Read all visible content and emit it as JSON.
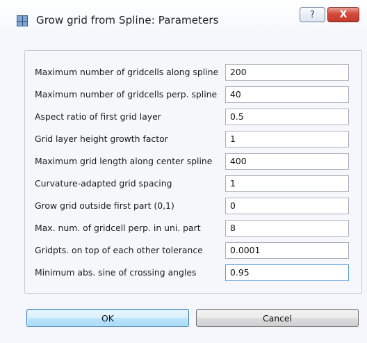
{
  "window": {
    "title": "Grow grid from Spline: Parameters",
    "help_label": "?",
    "close_label": "X"
  },
  "params": [
    {
      "label": "Maximum number of gridcells along spline",
      "value": "200"
    },
    {
      "label": "Maximum number of gridcells perp. spline",
      "value": "40"
    },
    {
      "label": "Aspect ratio of first grid layer",
      "value": "0.5"
    },
    {
      "label": "Grid layer height growth factor",
      "value": "1"
    },
    {
      "label": "Maximum grid length along center spline",
      "value": "400"
    },
    {
      "label": "Curvature-adapted grid spacing",
      "value": "1"
    },
    {
      "label": "Grow grid outside first part (0,1)",
      "value": "0"
    },
    {
      "label": "Max. num. of gridcell perp. in uni. part",
      "value": "8"
    },
    {
      "label": "Gridpts. on top of each other tolerance",
      "value": "0.0001"
    },
    {
      "label": "Minimum abs. sine of crossing angles",
      "value": "0.95"
    }
  ],
  "buttons": {
    "ok": "OK",
    "cancel": "Cancel"
  }
}
